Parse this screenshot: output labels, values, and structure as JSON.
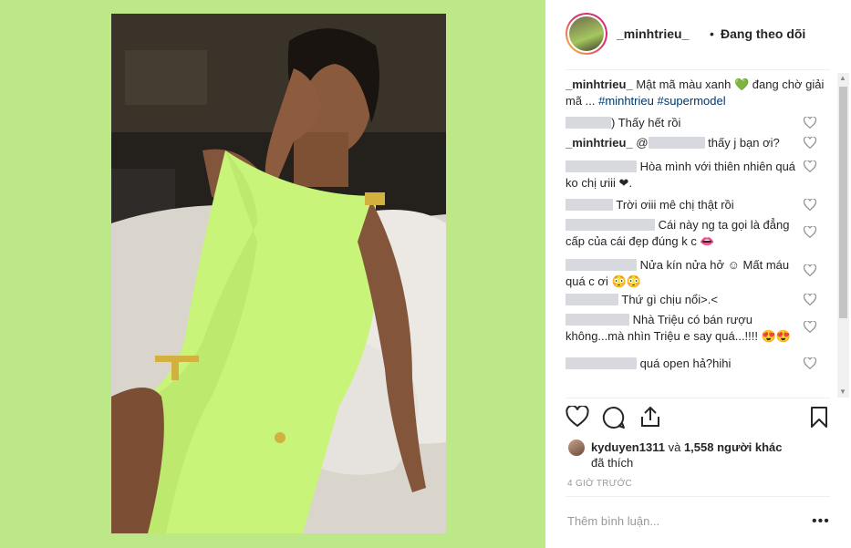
{
  "header": {
    "username": "_minhtrieu_",
    "dot": "•",
    "follow_status": "Đang theo dõi"
  },
  "caption": {
    "username": "_minhtrieu_",
    "text": "Mật mã màu xanh 💚 đang chờ giải mã ...",
    "hashtag1": "#minhtrieu",
    "hashtag2": "#supermodel"
  },
  "comments": [
    {
      "text": ") Thấy hết rồi"
    },
    {
      "username": "_minhtrieu_",
      "mention_prefix": "@",
      "text": "thấy j bạn ơi?"
    },
    {
      "text": "Hòa mình với thiên nhiên quá ko chị ưiii ❤."
    },
    {
      "text": "Trời ơiii mê chị thật rồi"
    },
    {
      "text": "Cái này ng ta gọi là đẳng cấp của cái đẹp đúng k c 👄"
    },
    {
      "text": "Nửa kín nửa hở ☺ Mất máu quá c ơi 😳😳"
    },
    {
      "text": "Thứ gì chịu nổi>.<"
    },
    {
      "text": "Nhà Triệu có bán rượu không...mà nhìn Triệu e say quá...!!!! 😍😍"
    },
    {
      "text": "quá open hả?hihi"
    }
  ],
  "likes": {
    "user": "kyduyen1311",
    "and": "và",
    "count": "1,558 người khác",
    "suffix": "đã thích"
  },
  "time": "4 GIỜ TRƯỚC",
  "comment_placeholder": "Thêm bình luận...",
  "more": "•••",
  "colors": {
    "background_green": "#bde888",
    "dress_green": "#c8f47a",
    "hashtag": "#003569"
  },
  "icons": [
    "heart-icon",
    "comment-icon",
    "share-icon",
    "bookmark-icon",
    "more-icon"
  ]
}
